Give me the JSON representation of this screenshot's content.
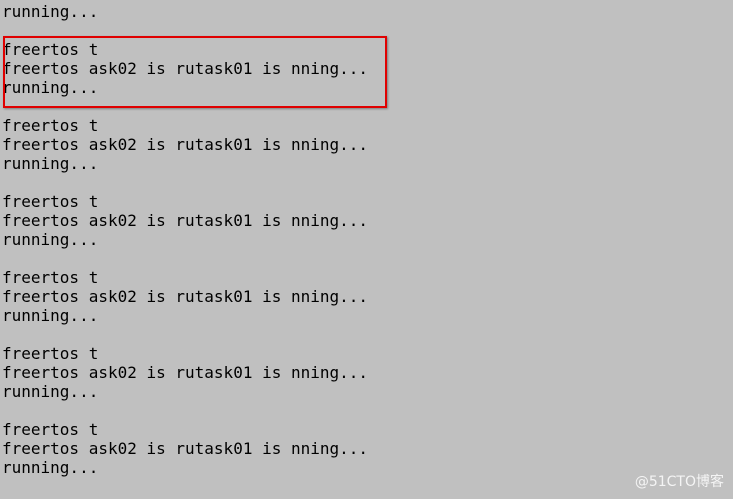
{
  "console": {
    "lines": [
      "running...",
      "",
      "freertos t",
      "freertos ask02 is rutask01 is nning...",
      "running...",
      "",
      "freertos t",
      "freertos ask02 is rutask01 is nning...",
      "running...",
      "",
      "freertos t",
      "freertos ask02 is rutask01 is nning...",
      "running...",
      "",
      "freertos t",
      "freertos ask02 is rutask01 is nning...",
      "running...",
      "",
      "freertos t",
      "freertos ask02 is rutask01 is nning...",
      "running...",
      "",
      "freertos t",
      "freertos ask02 is rutask01 is nning...",
      "running..."
    ],
    "highlight_color": "#e00000",
    "background_color": "#c0c0c0"
  },
  "watermark": {
    "text": "@51CTO博客"
  }
}
